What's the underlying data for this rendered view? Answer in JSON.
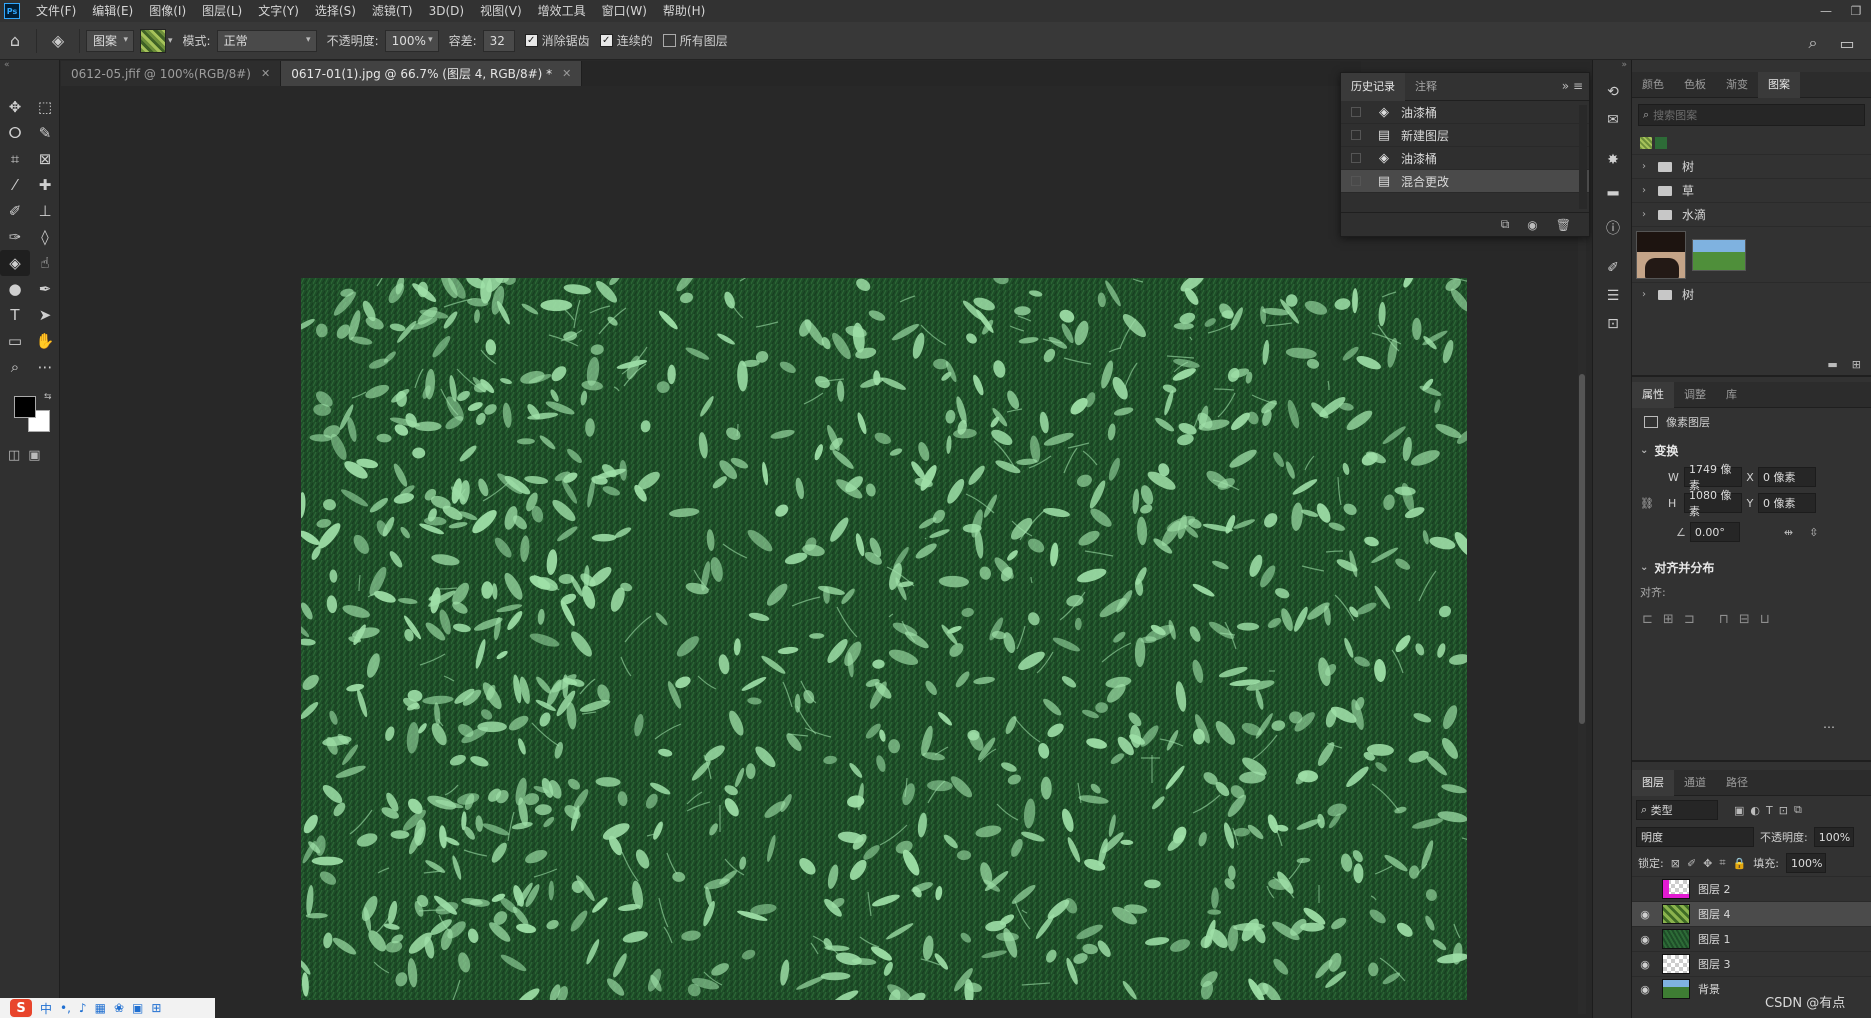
{
  "menubar": {
    "logo": "Ps",
    "items": [
      "文件(F)",
      "编辑(E)",
      "图像(I)",
      "图层(L)",
      "文字(Y)",
      "选择(S)",
      "滤镜(T)",
      "3D(D)",
      "视图(V)",
      "增效工具",
      "窗口(W)",
      "帮助(H)"
    ]
  },
  "options": {
    "fill_source": "图案",
    "mode_label": "模式:",
    "mode_value": "正常",
    "opacity_label": "不透明度:",
    "opacity_value": "100%",
    "tolerance_label": "容差:",
    "tolerance_value": "32",
    "antialias_label": "消除锯齿",
    "antialias_checked": true,
    "contiguous_label": "连续的",
    "contiguous_checked": true,
    "all_layers_label": "所有图层",
    "all_layers_checked": false
  },
  "tabs": [
    {
      "label": "0612-05.jfif @ 100%(RGB/8#)",
      "active": false
    },
    {
      "label": "0617-01(1).jpg @ 66.7% (图层 4, RGB/8#) *",
      "active": true
    }
  ],
  "history_panel": {
    "tabs": [
      "历史记录",
      "注释"
    ],
    "items": [
      {
        "label": "油漆桶",
        "icon": "paint-bucket-icon",
        "active": false
      },
      {
        "label": "新建图层",
        "icon": "layer-icon",
        "active": false
      },
      {
        "label": "油漆桶",
        "icon": "paint-bucket-icon",
        "active": false
      },
      {
        "label": "混合更改",
        "icon": "layer-icon",
        "active": true
      }
    ]
  },
  "patterns_panel": {
    "tabs": [
      "颜色",
      "色板",
      "渐变",
      "图案"
    ],
    "active_tab": "图案",
    "search_placeholder": "搜索图案",
    "groups": [
      "树",
      "草",
      "水滴",
      "树"
    ]
  },
  "properties_panel": {
    "tabs": [
      "属性",
      "调整",
      "库"
    ],
    "layer_type": "像素图层",
    "transform_title": "变换",
    "w_label": "W",
    "w_value": "1749 像素",
    "x_label": "X",
    "x_value": "0 像素",
    "h_label": "H",
    "h_value": "1080 像素",
    "y_label": "Y",
    "y_value": "0 像素",
    "angle_value": "0.00°",
    "align_title": "对齐并分布",
    "align_label": "对齐:"
  },
  "layers_panel": {
    "tabs": [
      "图层",
      "通道",
      "路径"
    ],
    "filter_kind": "类型",
    "blend_mode": "明度",
    "opacity_label": "不透明度:",
    "opacity_value": "100%",
    "lock_label": "锁定:",
    "fill_label": "填充:",
    "fill_value": "100%",
    "layers": [
      {
        "name": "图层 2",
        "visible": false,
        "active": false,
        "thumb": "magenta"
      },
      {
        "name": "图层 4",
        "visible": true,
        "active": true,
        "thumb": "leaves"
      },
      {
        "name": "图层 1",
        "visible": true,
        "active": false,
        "thumb": "grass"
      },
      {
        "name": "图层 3",
        "visible": true,
        "active": false,
        "thumb": "checker"
      },
      {
        "name": "背景",
        "visible": true,
        "active": false,
        "thumb": "landscape"
      }
    ]
  },
  "taskbar": {
    "ime_logo": "S",
    "ime_text": "中"
  },
  "watermark": "CSDN @有点",
  "colors": {
    "foreground": "#000000",
    "background": "#ffffff",
    "leaf": "#9fe0a8",
    "grass": "#1e4d28"
  }
}
